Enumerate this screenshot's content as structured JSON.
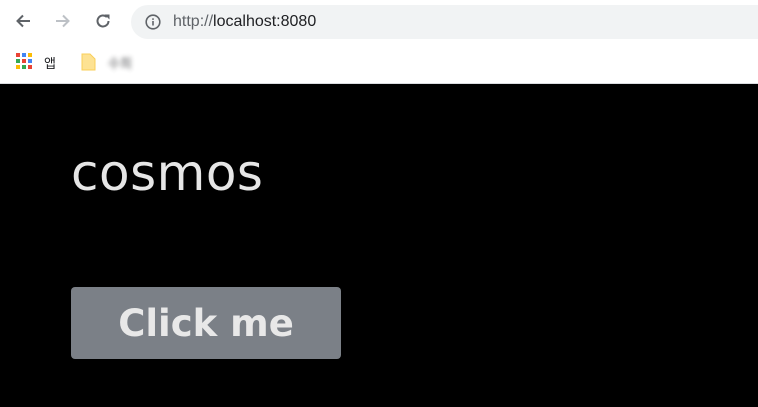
{
  "browser": {
    "url_scheme": "http://",
    "url_host": "localhost:8080",
    "bookmarks": [
      {
        "label": "앱",
        "icon": "apps-grid-icon"
      },
      {
        "label": "수희",
        "icon": "folder-icon"
      }
    ]
  },
  "page": {
    "title": "cosmos",
    "button_label": "Click me",
    "colors": {
      "background": "#000000",
      "text": "#e6e6e6",
      "button_bg": "#7b8087"
    }
  }
}
